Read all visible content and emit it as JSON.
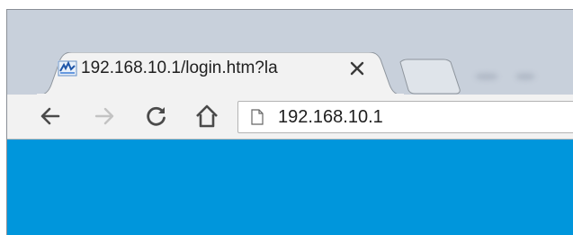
{
  "tab": {
    "title": "192.168.10.1/login.htm?la",
    "favicon": "router-favicon",
    "close_icon": "close-icon"
  },
  "new_tab": {
    "icon": "new-tab-icon"
  },
  "toolbar": {
    "back_icon": "back-arrow-icon",
    "forward_icon": "forward-arrow-icon",
    "reload_icon": "reload-icon",
    "home_icon": "home-icon"
  },
  "omnibox": {
    "page_icon": "page-icon",
    "url": "192.168.10.1"
  },
  "colors": {
    "frame": "#c8d0db",
    "tab_active": "#f2f2f2",
    "content_accent": "#0096dc"
  }
}
